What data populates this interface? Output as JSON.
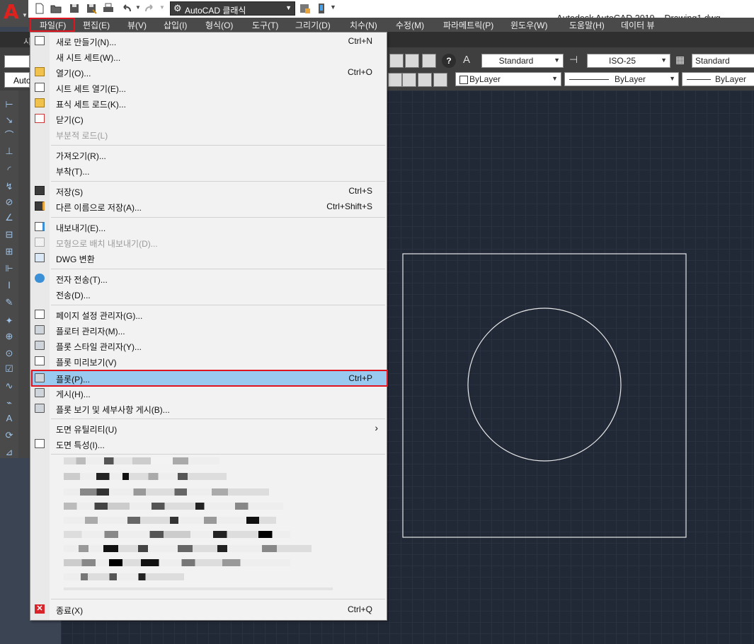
{
  "title_bar": {
    "app_title": "Autodesk AutoCAD 2019",
    "document": "Drawing1.dwg",
    "workspace": "AutoCAD 클래식"
  },
  "menubar": {
    "items": [
      "파일(F)",
      "편집(E)",
      "뷰(V)",
      "삽입(I)",
      "형식(O)",
      "도구(T)",
      "그리기(D)",
      "치수(N)",
      "수정(M)",
      "파라메트릭(P)",
      "윈도우(W)",
      "도움말(H)",
      "데이터 뷰"
    ]
  },
  "toolbar": {
    "text_style": "Standard",
    "dim_style": "ISO-25",
    "table_style": "Standard",
    "layer_color": "ByLayer",
    "linetype": "ByLayer",
    "lineweight": "ByLayer",
    "ribbon_tab_fragment": "시",
    "layer_fragment": "Auto"
  },
  "file_menu": {
    "items": [
      {
        "label": "새로 만들기(N)...",
        "shortcut": "Ctrl+N",
        "icon": "new-doc-icon"
      },
      {
        "label": "새 시트 세트(W)...",
        "shortcut": "",
        "icon": ""
      },
      {
        "label": "열기(O)...",
        "shortcut": "Ctrl+O",
        "icon": "open-folder-icon"
      },
      {
        "label": "시트 세트 열기(E)...",
        "shortcut": "",
        "icon": "sheet-set-icon"
      },
      {
        "label": "표식 세트 로드(K)...",
        "shortcut": "",
        "icon": "markup-icon"
      },
      {
        "label": "닫기(C)",
        "shortcut": "",
        "icon": "close-doc-icon"
      },
      {
        "label": "부분적 로드(L)",
        "shortcut": "",
        "icon": ""
      },
      {
        "label": "가져오기(R)...",
        "shortcut": "",
        "icon": ""
      },
      {
        "label": "부착(T)...",
        "shortcut": "",
        "icon": ""
      },
      {
        "label": "저장(S)",
        "shortcut": "Ctrl+S",
        "icon": "save-icon"
      },
      {
        "label": "다른 이름으로 저장(A)...",
        "shortcut": "Ctrl+Shift+S",
        "icon": "save-as-icon"
      },
      {
        "label": "내보내기(E)...",
        "shortcut": "",
        "icon": "export-icon"
      },
      {
        "label": "모형으로 배치 내보내기(D)...",
        "shortcut": "",
        "icon": "export-layout-icon"
      },
      {
        "label": "DWG 변환",
        "shortcut": "",
        "icon": "dwg-convert-icon"
      },
      {
        "label": "전자 전송(T)...",
        "shortcut": "",
        "icon": "etransmit-icon"
      },
      {
        "label": "전송(D)...",
        "shortcut": "",
        "icon": ""
      },
      {
        "label": "페이지 설정 관리자(G)...",
        "shortcut": "",
        "icon": "page-setup-icon"
      },
      {
        "label": "플로터 관리자(M)...",
        "shortcut": "",
        "icon": "plotter-icon"
      },
      {
        "label": "플롯 스타일 관리자(Y)...",
        "shortcut": "",
        "icon": "plot-style-icon"
      },
      {
        "label": "플롯 미리보기(V)",
        "shortcut": "",
        "icon": "plot-preview-icon"
      },
      {
        "label": "플롯(P)...",
        "shortcut": "Ctrl+P",
        "icon": "plot-icon"
      },
      {
        "label": "게시(H)...",
        "shortcut": "",
        "icon": "publish-icon"
      },
      {
        "label": "플롯 보기 및 세부사항 게시(B)...",
        "shortcut": "",
        "icon": "plot-details-icon"
      },
      {
        "label": "도면 유틸리티(U)",
        "shortcut": "›",
        "icon": ""
      },
      {
        "label": "도면 특성(I)...",
        "shortcut": "",
        "icon": "drawing-props-icon"
      },
      {
        "label": "종료(X)",
        "shortcut": "Ctrl+Q",
        "icon": "exit-icon"
      }
    ]
  },
  "colors": {
    "highlight": "#99c9ef",
    "annotation_red": "#e0141e",
    "canvas": "#212836"
  }
}
